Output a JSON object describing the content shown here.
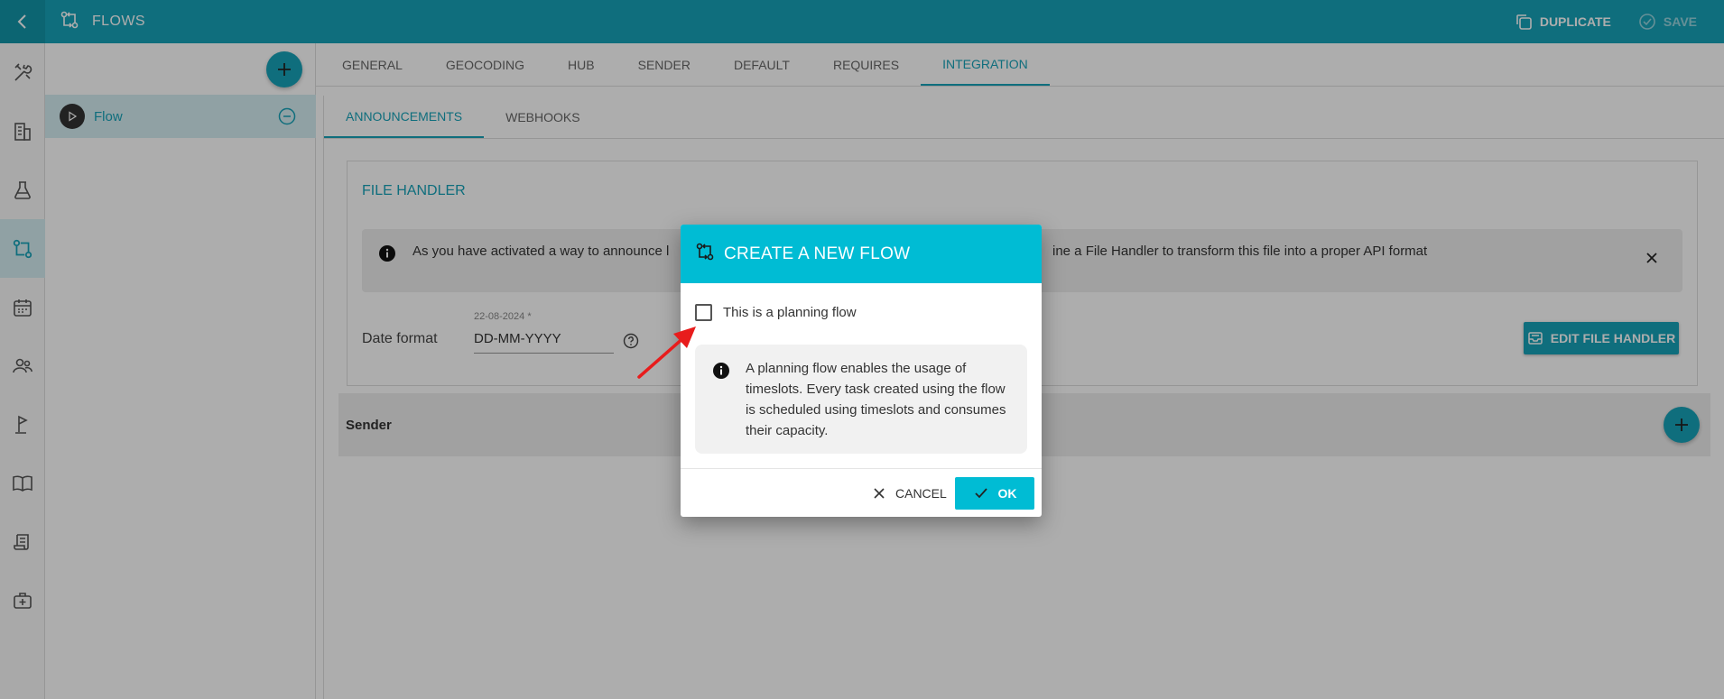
{
  "app": {
    "title": "FLOWS"
  },
  "top_actions": {
    "duplicate": "DUPLICATE",
    "save": "SAVE"
  },
  "flows": [
    {
      "name": "Flow"
    }
  ],
  "tabs": [
    "GENERAL",
    "GEOCODING",
    "HUB",
    "SENDER",
    "DEFAULT",
    "REQUIRES",
    "INTEGRATION"
  ],
  "active_tab": "INTEGRATION",
  "subtabs": [
    "ANNOUNCEMENTS",
    "WEBHOOKS"
  ],
  "active_subtab": "ANNOUNCEMENTS",
  "file_handler": {
    "title": "FILE HANDLER",
    "info_text_visible_left": "As you have activated a way to announce l",
    "info_text_visible_right": "ine a File Handler to transform this file into a proper API format",
    "date_label": "Date format",
    "date_hint": "22-08-2024 *",
    "date_value": "DD-MM-YYYY",
    "edit_button": "EDIT FILE HANDLER"
  },
  "sender_section": {
    "label": "Sender"
  },
  "dialog": {
    "title": "CREATE A NEW FLOW",
    "checkbox_label": "This is a planning flow",
    "checkbox_checked": false,
    "info": "A planning flow enables the usage of timeslots. Every task created using the flow is scheduled using timeslots and consumes their capacity.",
    "cancel": "CANCEL",
    "ok": "OK"
  },
  "colors": {
    "primary": "#17a2b8",
    "dialog_header": "#00bcd4",
    "annotation_arrow": "#e81c1c"
  }
}
